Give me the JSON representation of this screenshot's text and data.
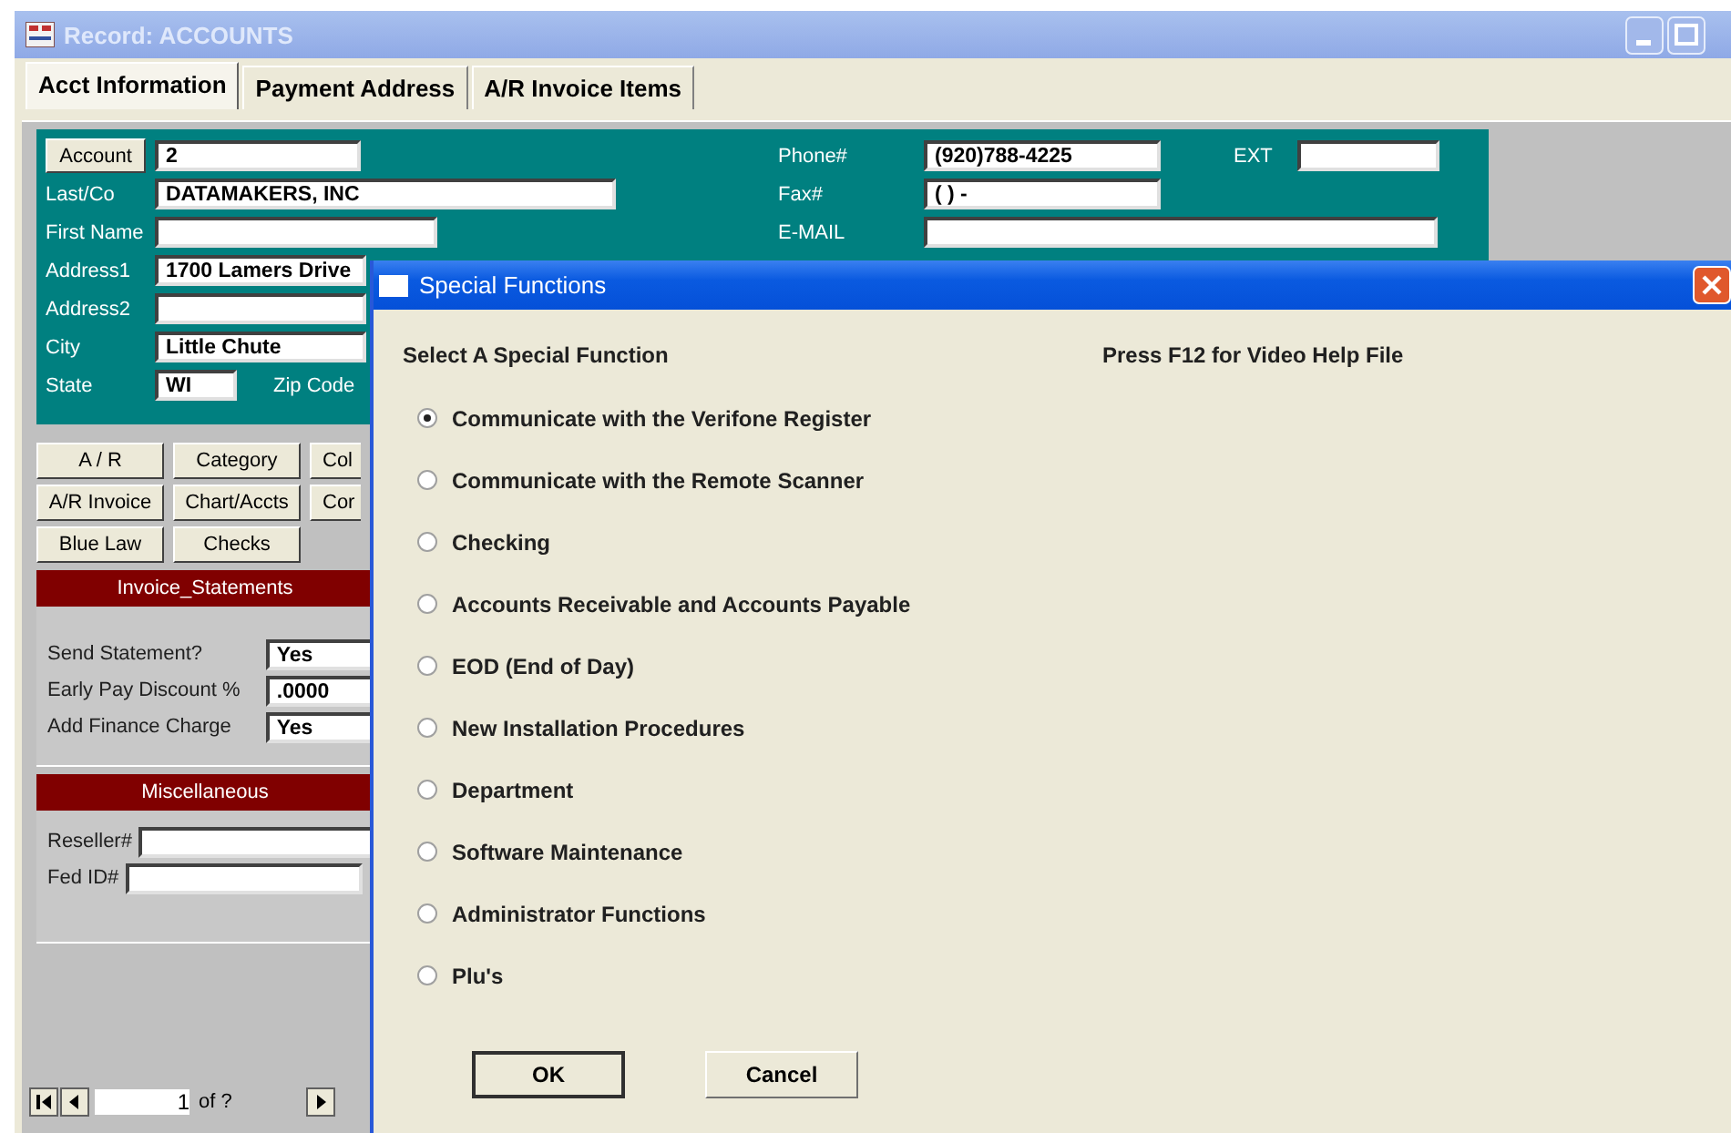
{
  "window": {
    "title": "Record: ACCOUNTS"
  },
  "tabs": [
    {
      "label": "Acct Information",
      "selected": true
    },
    {
      "label": "Payment Address",
      "selected": false
    },
    {
      "label": "A/R Invoice Items",
      "selected": false
    }
  ],
  "account": {
    "button": "Account",
    "value": "2"
  },
  "contact_fields": [
    {
      "label": "Last/Co",
      "value": "DATAMAKERS, INC"
    },
    {
      "label": "First Name"
    },
    {
      "label": "Address1",
      "value": "1700 Lamers Drive"
    },
    {
      "label": "Address2"
    },
    {
      "label": "City",
      "value": "Little Chute"
    }
  ],
  "state": {
    "label": "State",
    "value": "WI"
  },
  "zip": {
    "label": "Zip Code"
  },
  "phone_fields": [
    {
      "label": "Phone#",
      "value": "(920)788-4225"
    },
    {
      "label": "Fax#",
      "value": "(  )  -"
    },
    {
      "label": "E-MAIL"
    }
  ],
  "ext": {
    "label": "EXT"
  },
  "function_buttons": [
    "A / R",
    "Category",
    "Col",
    "A/R Invoice",
    "Chart/Accts",
    "Cor",
    "Blue Law",
    "Checks"
  ],
  "sections": [
    {
      "title": "Invoice_Statements",
      "fields": [
        {
          "label": "Send Statement?",
          "value": "Yes"
        },
        {
          "label": "Early Pay Discount %",
          "value": ".0000"
        },
        {
          "label": "Add Finance Charge",
          "value": "Yes"
        }
      ]
    },
    {
      "title": "Miscellaneous",
      "fields": [
        {
          "label": "Reseller#"
        },
        {
          "label": "Fed ID#"
        }
      ]
    }
  ],
  "navigator": {
    "record": "1",
    "total": "of ?"
  },
  "dialog": {
    "title": "Special Functions",
    "prompt": "Select A Special Function",
    "help": "Press F12 for Video Help File",
    "options": [
      {
        "label": "Communicate with the Verifone Register",
        "selected": true
      },
      {
        "label": "Communicate with the Remote Scanner",
        "selected": false
      },
      {
        "label": "Checking",
        "selected": false
      },
      {
        "label": "Accounts Receivable and Accounts Payable",
        "selected": false
      },
      {
        "label": "EOD (End of Day)",
        "selected": false
      },
      {
        "label": "New Installation Procedures",
        "selected": false
      },
      {
        "label": "Department",
        "selected": false
      },
      {
        "label": "Software Maintenance",
        "selected": false
      },
      {
        "label": "Administrator Functions",
        "selected": false
      },
      {
        "label": "Plu's",
        "selected": false
      }
    ],
    "buttons": [
      "OK",
      "Cancel"
    ]
  }
}
